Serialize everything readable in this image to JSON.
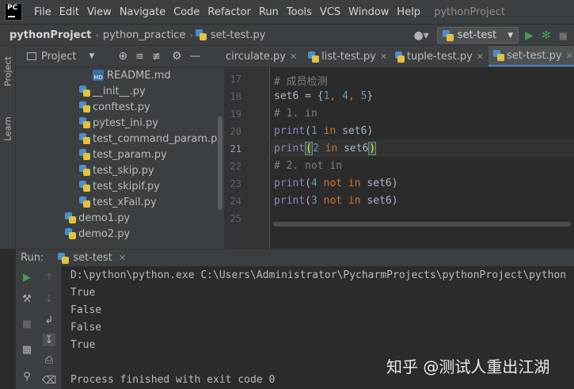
{
  "menubar": {
    "logo_text": "PC",
    "items": [
      "File",
      "Edit",
      "View",
      "Navigate",
      "Code",
      "Refactor",
      "Run",
      "Tools",
      "VCS",
      "Window",
      "Help"
    ],
    "project_title": "pythonProject"
  },
  "navbar": {
    "crumbs": [
      "pythonProject",
      "python_practice",
      "set-test.py"
    ],
    "run_config": "set-test"
  },
  "left_strip": {
    "project_tab": "Project",
    "learn_tab": "Learn"
  },
  "project_panel": {
    "title": "Project",
    "files": [
      {
        "name": "README.md",
        "type": "md"
      },
      {
        "name": "__init__.py",
        "type": "py"
      },
      {
        "name": "conftest.py",
        "type": "py"
      },
      {
        "name": "pytest_ini.py",
        "type": "py"
      },
      {
        "name": "test_command_param.py",
        "type": "py"
      },
      {
        "name": "test_param.py",
        "type": "py"
      },
      {
        "name": "test_skip.py",
        "type": "py"
      },
      {
        "name": "test_skipif.py",
        "type": "py"
      },
      {
        "name": "test_xFail.py",
        "type": "py"
      },
      {
        "name": "demo1.py",
        "type": "py"
      },
      {
        "name": "demo2.py",
        "type": "py"
      }
    ]
  },
  "editor": {
    "tabs": [
      "circulate.py",
      "list-test.py",
      "tuple-test.py",
      "set-test.py"
    ],
    "active_tab": "set-test.py",
    "line_numbers": [
      "17",
      "18",
      "19",
      "20",
      "21",
      "22",
      "23",
      "24",
      "25"
    ],
    "current_line": "21",
    "lines": {
      "l17": "# 成员检测",
      "l18_a": "set6 = {",
      "l18_n1": "1",
      "l18_s1": ", ",
      "l18_n2": "4",
      "l18_s2": ", ",
      "l18_n3": "5",
      "l18_b": "}",
      "l19": "# 1. in",
      "l20_fn": "print",
      "l20_o": "(",
      "l20_n": "1",
      "l20_kw": " in ",
      "l20_v": "set6)",
      "l21_fn": "print",
      "l21_o": "(",
      "l21_n": "2",
      "l21_kw": " in ",
      "l21_v": "set6",
      "l21_c": ")",
      "l22": "# 2. not in",
      "l23_fn": "print",
      "l23_o": "(",
      "l23_n": "4",
      "l23_kw": " not in ",
      "l23_v": "set6)",
      "l24_fn": "print",
      "l24_o": "(",
      "l24_n": "3",
      "l24_kw": " not in ",
      "l24_v": "set6)"
    }
  },
  "run_panel": {
    "label": "Run:",
    "config": "set-test",
    "console": [
      "D:\\python\\python.exe C:\\Users\\Administrator\\PycharmProjects\\pythonProject\\python",
      "True",
      "False",
      "False",
      "True",
      "",
      "Process finished with exit code 0"
    ]
  },
  "watermark": "知乎 @测试人重出江湖",
  "colors": {
    "accent": "#4a88c7",
    "run_green": "#499c54",
    "keyword": "#cc7832",
    "number": "#6897bb",
    "comment": "#808080",
    "builtin": "#8888c6"
  }
}
